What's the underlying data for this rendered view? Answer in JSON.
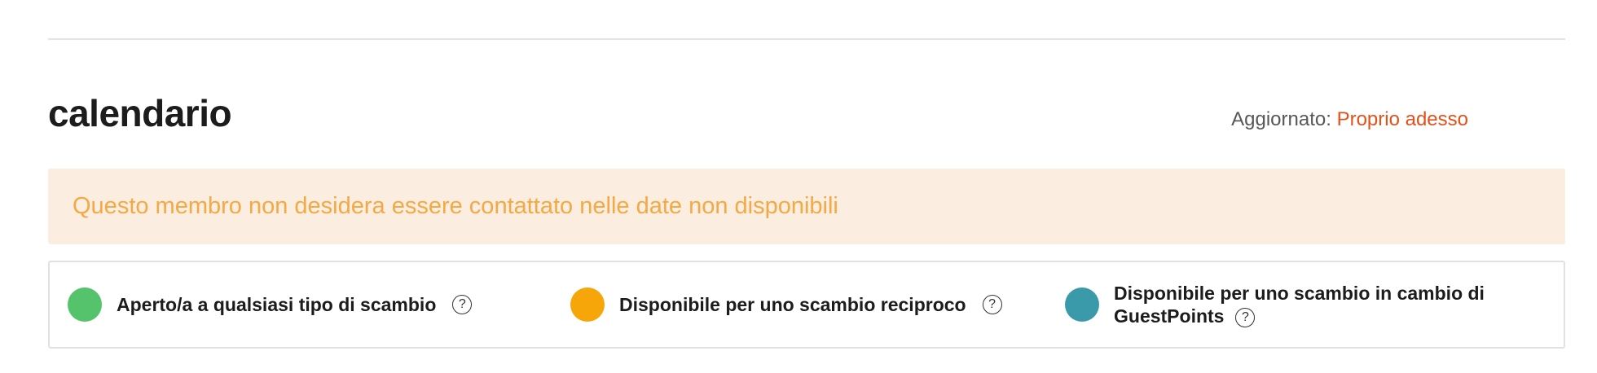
{
  "section": {
    "title": "calendario",
    "updated_label": "Aggiornato:",
    "updated_value": "Proprio adesso"
  },
  "notice": {
    "text": "Questo membro non desidera essere contattato nelle date non disponibili"
  },
  "legend": {
    "items": [
      {
        "label": "Aperto/a a qualsiasi tipo di scambio",
        "color": "#55c36b",
        "help_icon": "question-circle-icon"
      },
      {
        "label": "Disponibile per uno scambio reciproco",
        "color": "#f6a609",
        "help_icon": "question-circle-icon"
      },
      {
        "label_line1": "Disponibile per uno scambio in cambio di",
        "label_line2": "GuestPoints",
        "color": "#3a9aaa",
        "help_icon": "question-circle-icon"
      }
    ],
    "help_glyph": "?"
  },
  "colors": {
    "accent": "#e2511a",
    "notice_bg": "#fbede0",
    "notice_text": "#f3a944"
  }
}
